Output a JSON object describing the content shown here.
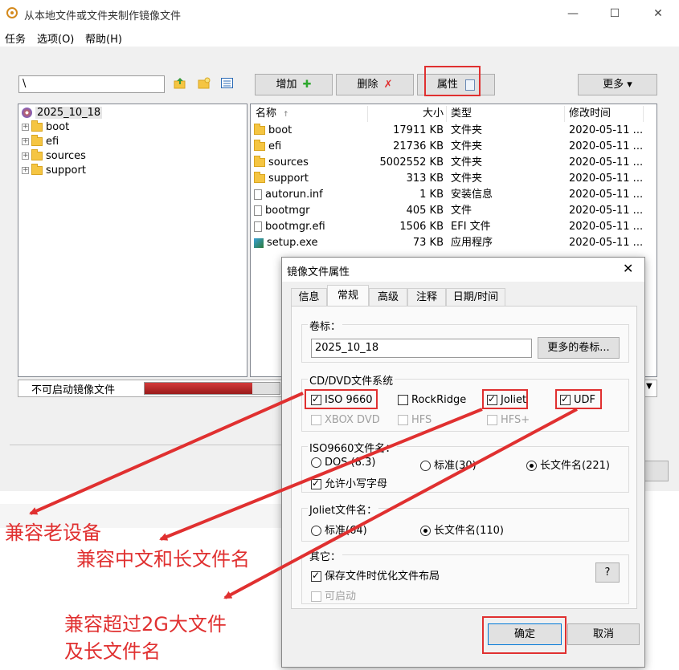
{
  "window": {
    "title": "从本地文件或文件夹制作镜像文件",
    "controls": [
      "—",
      "☐",
      "✕"
    ]
  },
  "menu": [
    "任务",
    "选项(O)",
    "帮助(H)"
  ],
  "path_value": "\\",
  "toolbar": {
    "add_label": "增加",
    "delete_label": "删除",
    "properties_label": "属性",
    "more_label": "更多 ▾"
  },
  "tree": {
    "root": "2025_10_18",
    "children": [
      "boot",
      "efi",
      "sources",
      "support"
    ]
  },
  "list": {
    "headers": [
      "名称",
      "大小",
      "类型",
      "修改时间"
    ],
    "rows": [
      {
        "name": "boot",
        "size": "17911 KB",
        "type": "文件夹",
        "time": "2020-05-11 ..."
      },
      {
        "name": "efi",
        "size": "21736 KB",
        "type": "文件夹",
        "time": "2020-05-11 ..."
      },
      {
        "name": "sources",
        "size": "5002552 KB",
        "type": "文件夹",
        "time": "2020-05-11 ..."
      },
      {
        "name": "support",
        "size": "313 KB",
        "type": "文件夹",
        "time": "2020-05-11 ..."
      },
      {
        "name": "autorun.inf",
        "size": "1 KB",
        "type": "安装信息",
        "time": "2020-05-11 ..."
      },
      {
        "name": "bootmgr",
        "size": "405 KB",
        "type": "文件",
        "time": "2020-05-11 ..."
      },
      {
        "name": "bootmgr.efi",
        "size": "1506 KB",
        "type": "EFI 文件",
        "time": "2020-05-11 ..."
      },
      {
        "name": "setup.exe",
        "size": "73 KB",
        "type": "应用程序",
        "time": "2020-05-11 ..."
      }
    ]
  },
  "status": {
    "boot_label": "不可启动镜像文件",
    "usage_fraction": 0.8
  },
  "dialog": {
    "title": "镜像文件属性",
    "close": "✕",
    "tabs": [
      "信息",
      "常规",
      "高级",
      "注释",
      "日期/时间"
    ],
    "active_tab": "常规",
    "volume_label_title": "卷标：",
    "volume_label_value": "2025_10_18",
    "more_labels_button": "更多的卷标...",
    "fs_title": "CD/DVD文件系统",
    "fs_options": {
      "iso9660": "ISO 9660",
      "rockridge": "RockRidge",
      "joliet": "Joliet",
      "udf": "UDF",
      "xbox": "XBOX DVD",
      "hfs": "HFS",
      "hfsplus": "HFS+"
    },
    "iso_names_title": "ISO9660文件名：",
    "iso_names": {
      "dos": "DOS (8.3)",
      "standard": "标准(30)",
      "long": "长文件名(221)",
      "lowercase": "允许小写字母"
    },
    "joliet_names_title": "Joliet文件名：",
    "joliet_names": {
      "standard": "标准(64)",
      "long": "长文件名(110)"
    },
    "other_title": "其它：",
    "other": {
      "optimize": "保存文件时优化文件布局",
      "bootable": "可启动",
      "help_button": "?"
    },
    "ok_button": "确定",
    "cancel_button": "取消"
  },
  "annotations": {
    "old_devices": "兼容老设备",
    "chinese_long": "兼容中文和长文件名",
    "large_files_line1": "兼容超过2G大文件",
    "large_files_line2": "及长文件名",
    "color": "#e03030"
  }
}
